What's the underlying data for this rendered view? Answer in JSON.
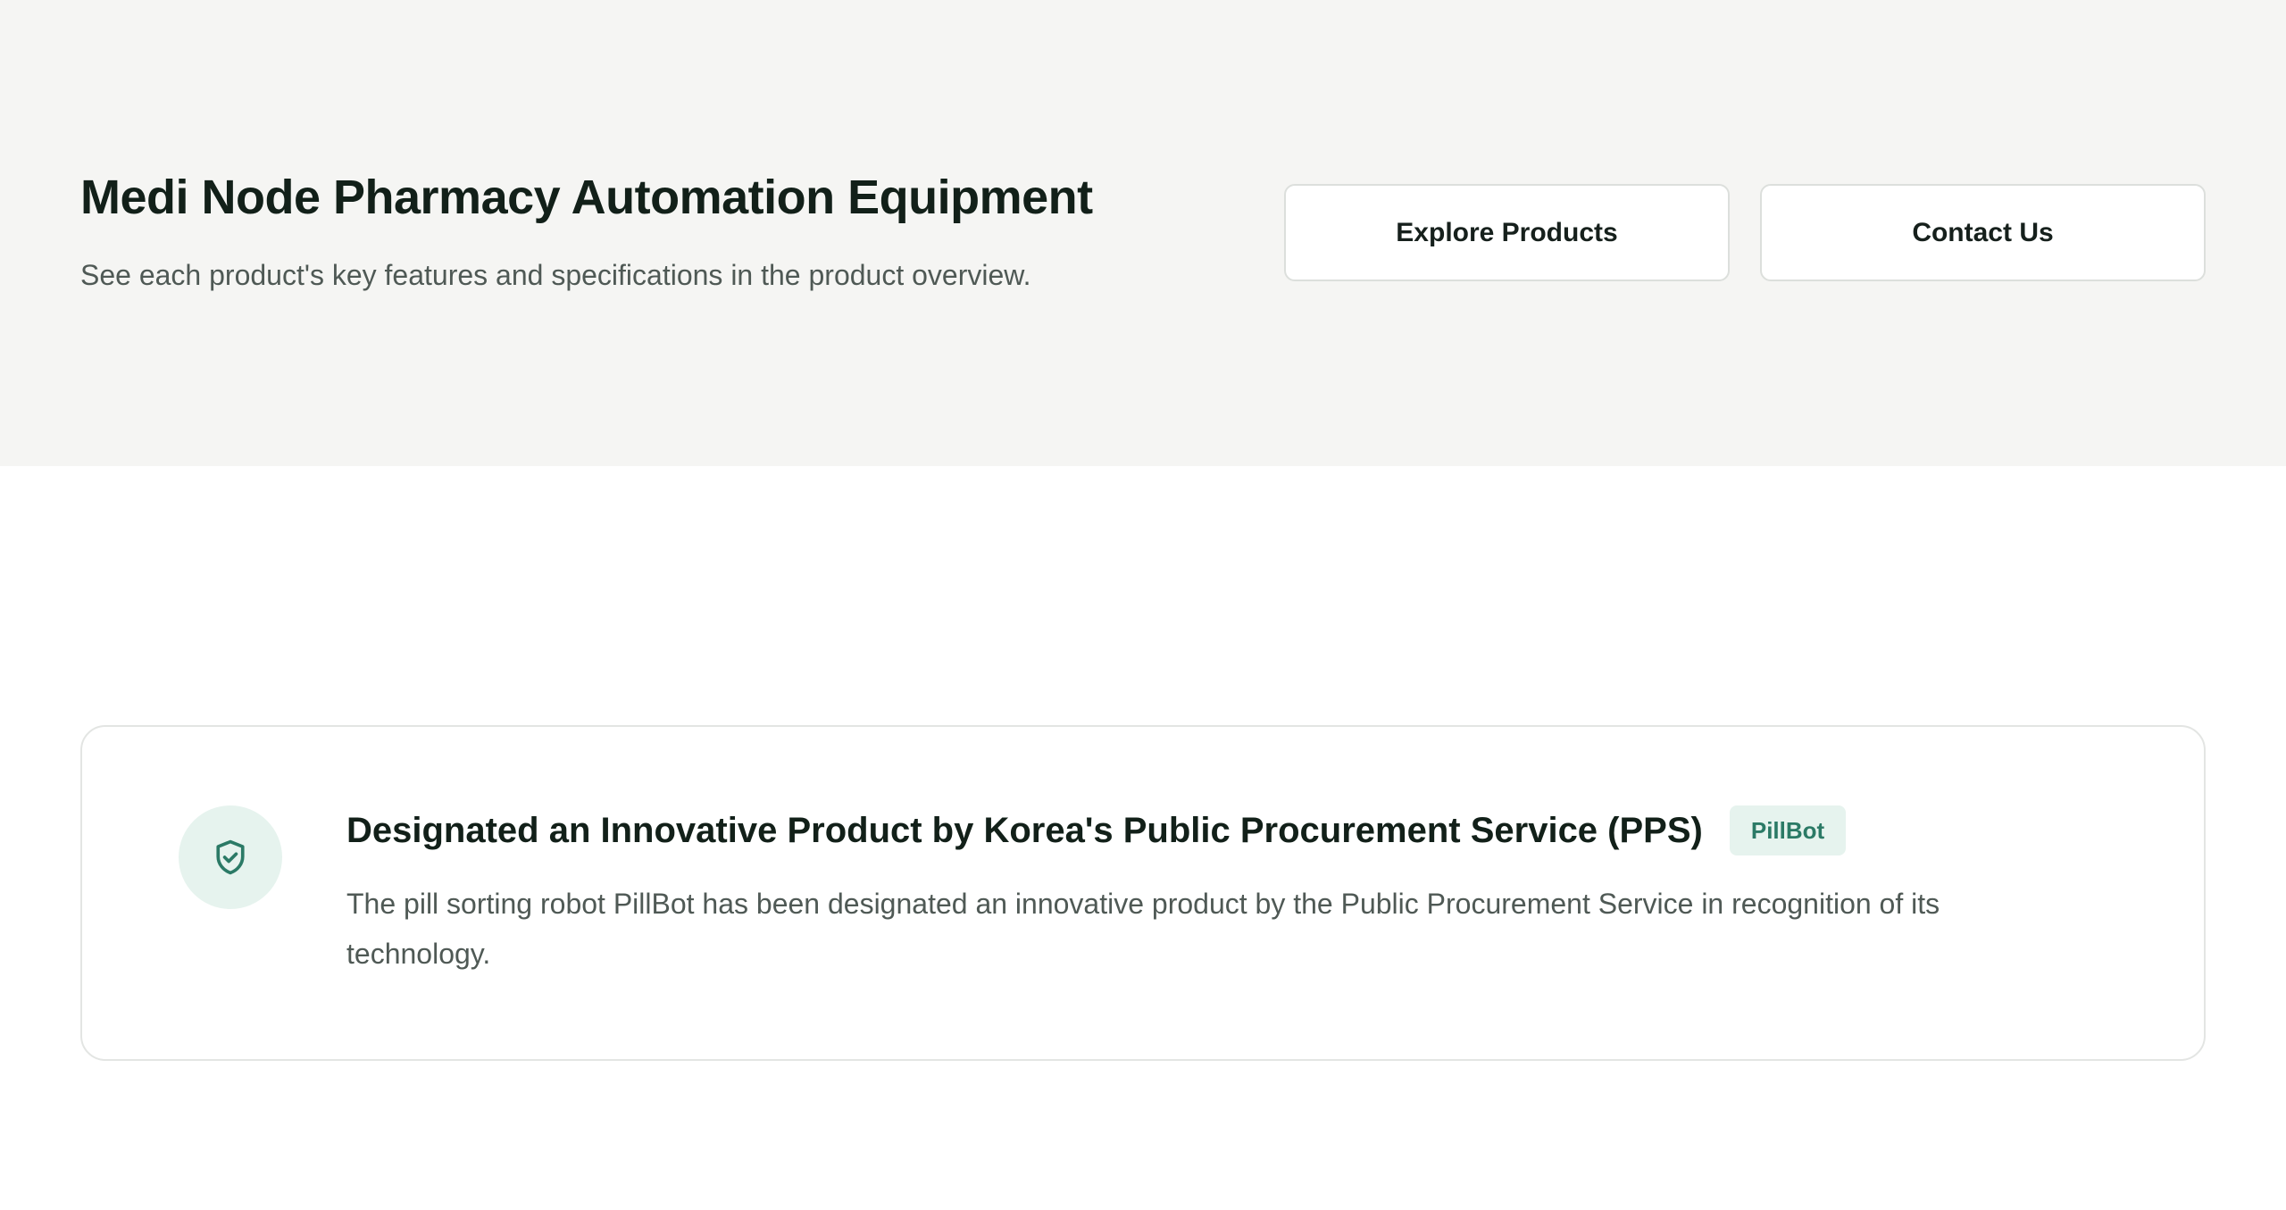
{
  "hero": {
    "title": "Medi Node Pharmacy Automation Equipment",
    "subtitle": "See each product's key features and specifications in the product overview.",
    "buttons": {
      "explore": "Explore Products",
      "contact": "Contact Us"
    }
  },
  "notice": {
    "icon": "shield-check-icon",
    "title": "Designated an Innovative Product by Korea's Public Procurement Service (PPS)",
    "tag": "PillBot",
    "description": "The pill sorting robot PillBot has been designated an innovative product by the Public Procurement Service in recognition of its technology."
  },
  "colors": {
    "hero_background": "#f5f5f3",
    "accent": "#2b7a66",
    "accent_soft": "#e6f3ee",
    "heading": "#122019",
    "body_text": "#4f5955"
  }
}
